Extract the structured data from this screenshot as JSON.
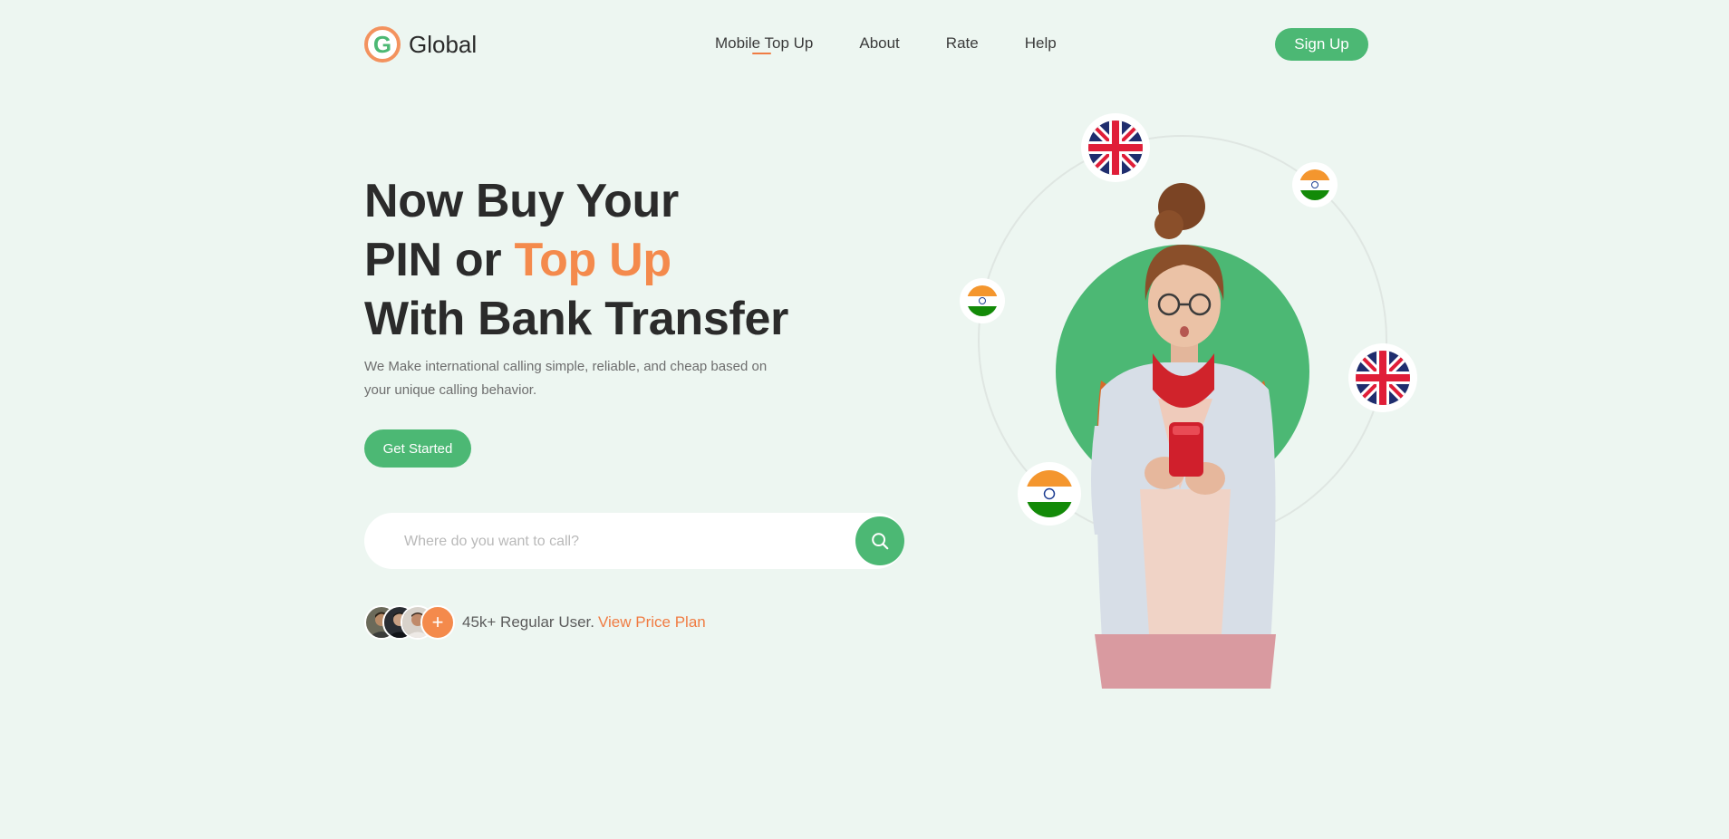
{
  "brand": {
    "logo_letter": "G",
    "name": "Global",
    "accent": "#f48a4c",
    "green": "#4cb874"
  },
  "nav": {
    "items": [
      {
        "label": "Mobile Top Up",
        "active": true
      },
      {
        "label": "About"
      },
      {
        "label": "Rate"
      },
      {
        "label": "Help"
      }
    ],
    "signup_label": "Sign Up"
  },
  "hero": {
    "title_line1": "Now Buy Your",
    "title_line2_pre": "PIN or ",
    "title_line2_accent": "Top Up",
    "title_line3": "With Bank Transfer",
    "subtitle": "We Make international calling simple, reliable, and cheap based on your unique calling behavior.",
    "cta_label": "Get Started"
  },
  "search": {
    "placeholder": "Where do you want to call?",
    "value": ""
  },
  "users": {
    "plus_symbol": "+",
    "text": "45k+ Regular User.",
    "link": "View Price Plan"
  },
  "icons": {
    "search": "search-icon",
    "flags": [
      "uk-flag-icon",
      "india-flag-icon"
    ]
  }
}
